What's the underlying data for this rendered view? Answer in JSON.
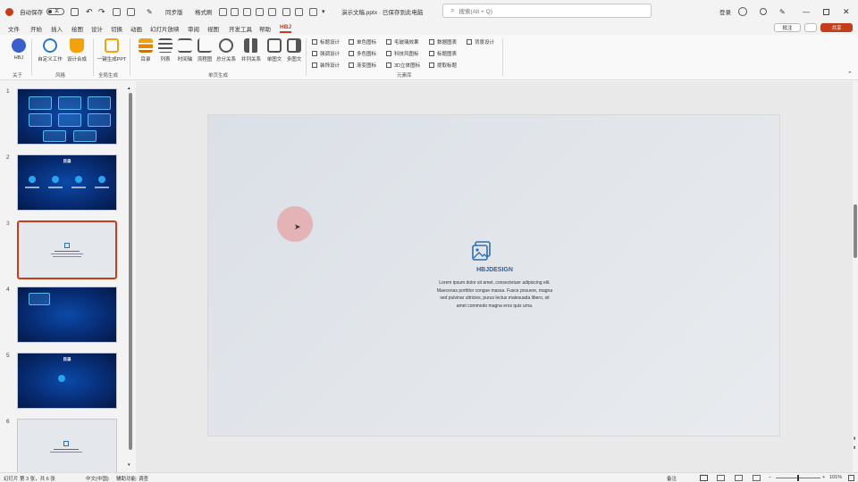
{
  "titlebar": {
    "autosave_label": "自动保存",
    "autosave_state": "关",
    "filename": "演示文稿.pptx · 已保存到此电脑",
    "search_placeholder": "搜索(Alt + Q)",
    "user_label": "登录",
    "share_label": "共享",
    "comment_label": "批注",
    "items": [
      "同步版",
      "格式刷"
    ]
  },
  "menu": {
    "tabs": [
      "文件",
      "开始",
      "插入",
      "绘图",
      "设计",
      "切换",
      "动画",
      "幻灯片放映",
      "审阅",
      "视图",
      "开发工具",
      "帮助",
      "HBJ"
    ],
    "active": "HBJ"
  },
  "ribbon": {
    "buttons": [
      {
        "label": "HBJ",
        "color": "#3a5fcd"
      },
      {
        "label": "自定义工作",
        "color": "#2f78c4"
      },
      {
        "label": "设计合成",
        "color": "#f2a20c"
      },
      {
        "label": "一键生成PPT",
        "color": "#f2a20c"
      },
      {
        "label": "目录",
        "color": "#f2a20c"
      },
      {
        "label": "列表",
        "color": "#555555"
      },
      {
        "label": "时间轴",
        "color": "#555555"
      },
      {
        "label": "流程图",
        "color": "#555555"
      },
      {
        "label": "总分关系",
        "color": "#555555"
      },
      {
        "label": "并列关系",
        "color": "#555555"
      },
      {
        "label": "单图文",
        "color": "#555555"
      },
      {
        "label": "多图文",
        "color": "#555555"
      }
    ],
    "groups": [
      "关于",
      "风格",
      "全局生成",
      "单页生成",
      "元素库"
    ],
    "checks": [
      [
        "标题设计",
        "单色图标",
        "毛玻璃效果",
        "数据图表",
        "背景设计"
      ],
      [
        "强调设计",
        "多色图标",
        "科技风图标",
        "标题图表"
      ],
      [
        "装饰设计",
        "渐变图标",
        "3D立体图标",
        "提取标题"
      ]
    ]
  },
  "slides": [
    {
      "num": "1",
      "theme": "dark"
    },
    {
      "num": "2",
      "theme": "dark",
      "title": "目录"
    },
    {
      "num": "3",
      "theme": "light",
      "selected": true
    },
    {
      "num": "4",
      "theme": "dark"
    },
    {
      "num": "5",
      "theme": "dark",
      "title": "目录"
    },
    {
      "num": "6",
      "theme": "light"
    }
  ],
  "slide_content": {
    "brand": "HBJDESIGN",
    "body": [
      "Lorem ipsum dolor sit amet, consectetuer adipiscing elit.",
      "Maecenas porttitor congue massa. Fusce posuere, magna",
      "sed pulvinar ultricies, purus lectus malesuada libero, sit",
      "amet commodo magna eros quis urna."
    ],
    "icon": "image-icon"
  },
  "statusbar": {
    "slide_info": "幻灯片 第 3 张，共 6 张",
    "language": "中文(中国)",
    "accessibility": "辅助功能: 调查",
    "notes": "备注",
    "zoom": "101%"
  },
  "colors": {
    "accent": "#c43e1c",
    "slide_icon": "#2d6fb0",
    "dark_slide": "#072a70"
  }
}
